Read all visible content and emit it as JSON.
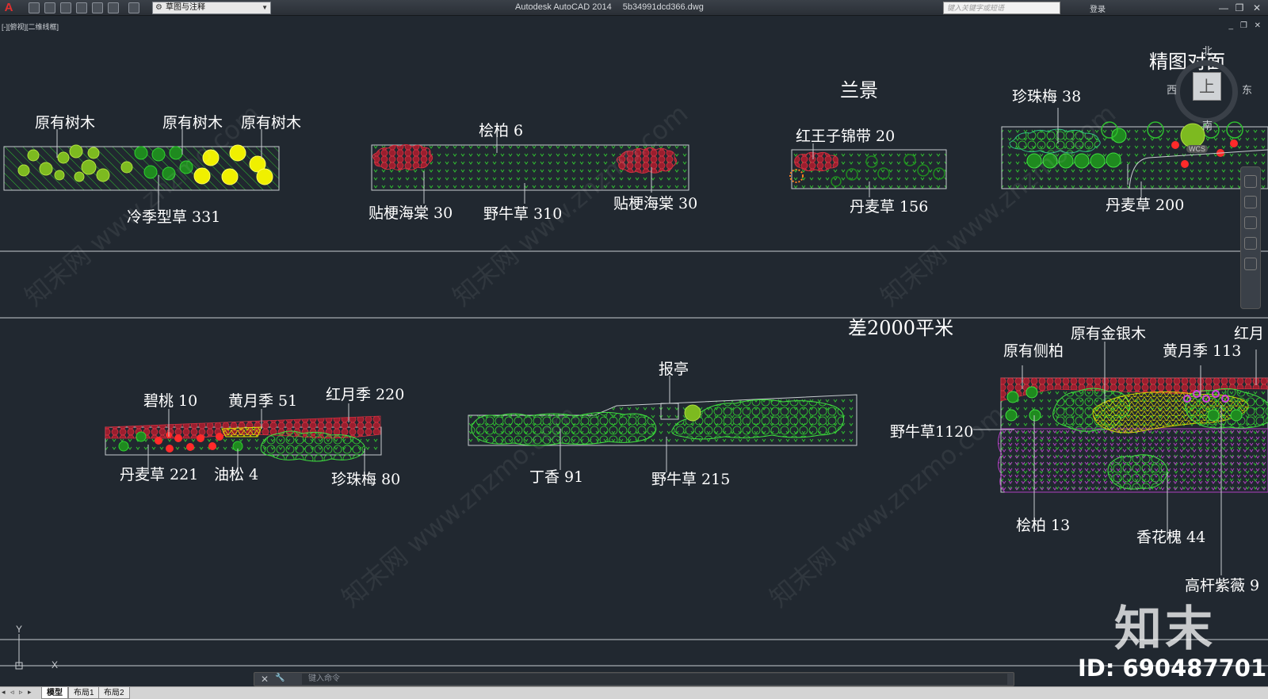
{
  "titlebar": {
    "logo": "A",
    "workspace": "草图与注释",
    "app_name": "Autodesk AutoCAD 2014",
    "file_name": "5b34991dcd366.dwg",
    "search_placeholder": "键入关键字或短语",
    "login": "登录",
    "minimize": "—",
    "restore": "❐",
    "close": "✕"
  },
  "viewport": {
    "label": "[-][俯视][二维线框]",
    "controls": "_ ❐ ✕"
  },
  "viewcube": {
    "face": "上",
    "north": "北",
    "south": "南",
    "east": "东",
    "west": "西",
    "wcs": "WCS"
  },
  "drawing": {
    "top_row": {
      "strip1_labels": [
        "原有树木",
        "原有树木",
        "原有树木",
        "冷季型草 331"
      ],
      "strip2_labels": [
        "桧柏 6",
        "贴梗海棠 30",
        "野牛草 310",
        "贴梗海棠 30"
      ],
      "strip3_labels": [
        "兰景",
        "红王子锦带 20",
        "丹麦草 156"
      ],
      "strip4_labels": [
        "精图对面",
        "珍珠梅 38",
        "丹麦草 200"
      ]
    },
    "bottom_row": {
      "section_title": "差2000平米",
      "strip1_labels": [
        "碧桃 10",
        "黄月季 51",
        "红月季 220",
        "丹麦草 221",
        "油松 4",
        "珍珠梅 80"
      ],
      "strip2_labels": [
        "报亭",
        "丁香 91",
        "野牛草 215"
      ],
      "strip3_labels": [
        "原有金银木",
        "红月",
        "原有侧柏",
        "黄月季 113",
        "野牛草1120",
        "桧柏 13",
        "香花槐 44",
        "高杆紫薇 9"
      ]
    }
  },
  "ucs": {
    "x": "X",
    "y": "Y"
  },
  "command": {
    "placeholder": "键入命令",
    "close": "✕",
    "tool": "🔧"
  },
  "status": {
    "nav": "◂ ◃ ▹ ▸",
    "tabs": [
      "模型",
      "布局1",
      "布局2"
    ]
  },
  "watermark": {
    "logo": "知末",
    "id": "ID: 690487701",
    "text": "知末网 www.znzmo.com"
  },
  "colors": {
    "background": "#212830",
    "grass": "#2fbf2f",
    "red": "#ff2a2a",
    "yellow": "#f0f000",
    "maroon": "#9a1e2e",
    "purple": "#b040c0"
  }
}
